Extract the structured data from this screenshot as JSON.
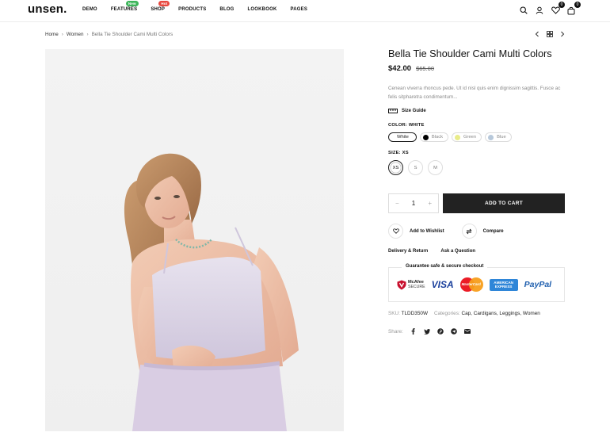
{
  "brand": {
    "logo": "unsen."
  },
  "nav": {
    "items": [
      {
        "label": "DEMO"
      },
      {
        "label": "FEATURES",
        "badge": "New"
      },
      {
        "label": "SHOP",
        "badge": "Hot"
      },
      {
        "label": "PRODUCTS"
      },
      {
        "label": "BLOG"
      },
      {
        "label": "LOOKBOOK"
      },
      {
        "label": "PAGES"
      }
    ]
  },
  "header_icons": {
    "wishlist_count": "0",
    "cart_count": "0"
  },
  "breadcrumb": {
    "home": "Home",
    "category": "Women",
    "current": "Bella Tie Shoulder Cami Multi Colors"
  },
  "product": {
    "title": "Bella Tie Shoulder Cami Multi Colors",
    "price": "$42.00",
    "old_price": "$65.00",
    "description": "Cenean viverra rhoncus pede. Ut id nisl quis enim dignissim sagittis. Fusce ac felis sitpharetra condimentum...",
    "size_guide": "Size Guide",
    "color_label": "COLOR:",
    "color_value": "WHITE",
    "colors": [
      {
        "name": "White",
        "hex": "#ffffff"
      },
      {
        "name": "Black",
        "hex": "#000000"
      },
      {
        "name": "Green",
        "hex": "#e9ec8a"
      },
      {
        "name": "Blue",
        "hex": "#b7c8da"
      }
    ],
    "size_label": "SIZE:",
    "size_value": "XS",
    "sizes": [
      "XS",
      "S",
      "M"
    ],
    "quantity": "1",
    "qty_minus": "−",
    "qty_plus": "+",
    "add_to_cart": "ADD TO CART",
    "wishlist": "Add to Wishlist",
    "compare": "Compare",
    "delivery_return": "Delivery & Return",
    "ask_question": "Ask a Question",
    "guarantee": "Guarantee safe & secure checkout",
    "payments": {
      "mcafee_line1": "McAfee",
      "mcafee_line2": "SECURE",
      "visa": "VISA",
      "mastercard": "MasterCard",
      "amex_line1": "AMERICAN",
      "amex_line2": "EXPRESS",
      "paypal": "PayPal"
    },
    "sku_label": "SKU:",
    "sku": "TLDD350W",
    "categories_label": "Categories:",
    "categories": "Cap, Cardigans, Leggings, Women",
    "share_label": "Share:"
  },
  "colors": {
    "accent": "#222222",
    "badge_new": "#3db55a",
    "badge_hot": "#e8473d"
  }
}
